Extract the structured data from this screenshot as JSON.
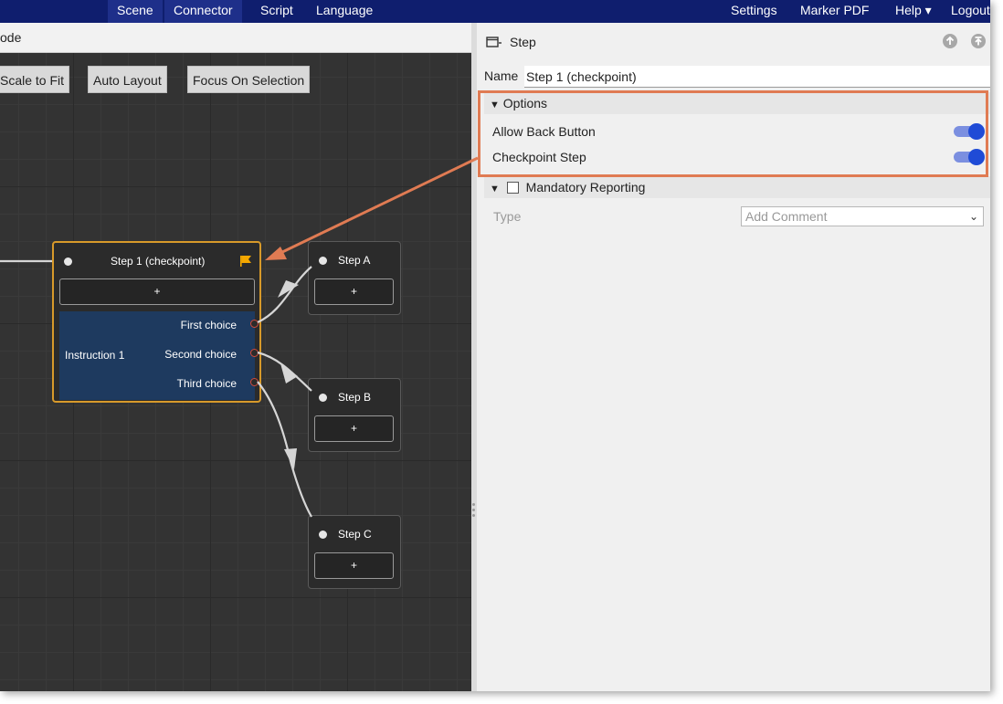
{
  "nav": {
    "items": [
      {
        "label": "Scene",
        "active": true
      },
      {
        "label": "Connector",
        "active": true
      },
      {
        "label": "Script",
        "active": false
      },
      {
        "label": "Language",
        "active": false
      }
    ],
    "right_items": [
      "Settings",
      "Marker PDF",
      "Help ▾",
      "Logout"
    ]
  },
  "graph": {
    "header_title": "ode",
    "toolbar": [
      "Scale to Fit",
      "Auto Layout",
      "Focus On Selection"
    ],
    "selected_node": {
      "title": "Step 1 (checkpoint)",
      "add_label": "+",
      "instruction": "Instruction 1",
      "choices": [
        "First choice",
        "Second choice",
        "Third choice"
      ],
      "flag_color": "#f5a800"
    },
    "nodes": [
      {
        "title": "Step A",
        "add_label": "+"
      },
      {
        "title": "Step B",
        "add_label": "+"
      },
      {
        "title": "Step C",
        "add_label": "+"
      }
    ]
  },
  "panel": {
    "title": "Step",
    "name_label": "Name",
    "name_value": "Step 1 (checkpoint)",
    "options_section": "Options",
    "allow_back_label": "Allow Back Button",
    "allow_back_on": true,
    "checkpoint_label": "Checkpoint Step",
    "checkpoint_on": true,
    "mandatory_section": "Mandatory Reporting",
    "mandatory_checked": false,
    "type_label": "Type",
    "type_value": "Add Comment"
  },
  "colors": {
    "nav_bg": "#0f1e6e",
    "canvas_bg": "#333333",
    "selected_border": "#d89a2a",
    "instruction_bg": "#1e3a5f",
    "toggle_on": "#1f4bd6",
    "annotation": "#e07b53"
  }
}
